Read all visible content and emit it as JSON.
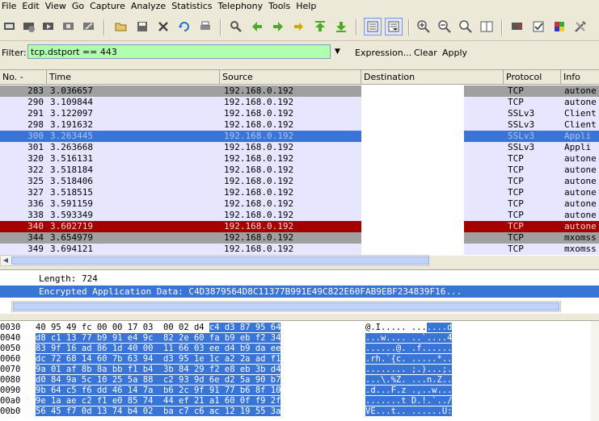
{
  "menu": [
    "File",
    "Edit",
    "View",
    "Go",
    "Capture",
    "Analyze",
    "Statistics",
    "Telephony",
    "Tools",
    "Help"
  ],
  "toolbar": {
    "icons": [
      "interface-list-icon",
      "capture-options-icon",
      "start-capture-icon",
      "stop-capture-icon",
      "restart-capture-icon",
      "open-file-icon",
      "save-file-icon",
      "close-file-icon",
      "reload-icon",
      "print-icon",
      "find-icon",
      "back-icon",
      "forward-icon",
      "goto-packet-icon",
      "first-packet-icon",
      "last-packet-icon",
      "colorize-icon",
      "autoscroll-icon",
      "zoom-in-icon",
      "zoom-out-icon",
      "zoom-normal-icon",
      "resize-columns-icon",
      "capture-filters-icon",
      "display-filters-icon",
      "coloring-rules-icon",
      "preferences-icon"
    ]
  },
  "filter": {
    "label": "Filter:",
    "value": "tcp.dstport == 443",
    "expression_label": "Expression...",
    "clear_label": "Clear",
    "apply_label": "Apply",
    "valid_color": "#afffaf"
  },
  "packet_list": {
    "columns": [
      "No. -",
      "Time",
      "Source",
      "Destination",
      "Protocol",
      "Info"
    ],
    "rows": [
      {
        "no": "283",
        "time": "3.036657",
        "source": "192.168.0.192",
        "protocol": "TCP",
        "info": "autone",
        "bg": "#a0a0a0",
        "fg": "#000000"
      },
      {
        "no": "290",
        "time": "3.109844",
        "source": "192.168.0.192",
        "protocol": "TCP",
        "info": "autone",
        "bg": "#e7e6ff",
        "fg": "#000000"
      },
      {
        "no": "291",
        "time": "3.122097",
        "source": "192.168.0.192",
        "protocol": "SSLv3",
        "info": "Client",
        "bg": "#e7e6ff",
        "fg": "#000000"
      },
      {
        "no": "298",
        "time": "3.191632",
        "source": "192.168.0.192",
        "protocol": "SSLv3",
        "info": "Client",
        "bg": "#e7e6ff",
        "fg": "#000000"
      },
      {
        "no": "300",
        "time": "3.263445",
        "source": "192.168.0.192",
        "protocol": "SSLv3",
        "info": "Appli",
        "bg": "#3875d7",
        "fg": "#a9c5ff"
      },
      {
        "no": "301",
        "time": "3.263668",
        "source": "192.168.0.192",
        "protocol": "SSLv3",
        "info": "Appli",
        "bg": "#e7e6ff",
        "fg": "#000000"
      },
      {
        "no": "320",
        "time": "3.516131",
        "source": "192.168.0.192",
        "protocol": "TCP",
        "info": "autone",
        "bg": "#e7e6ff",
        "fg": "#000000"
      },
      {
        "no": "322",
        "time": "3.518184",
        "source": "192.168.0.192",
        "protocol": "TCP",
        "info": "autone",
        "bg": "#e7e6ff",
        "fg": "#000000"
      },
      {
        "no": "325",
        "time": "3.518406",
        "source": "192.168.0.192",
        "protocol": "TCP",
        "info": "autone",
        "bg": "#e7e6ff",
        "fg": "#000000"
      },
      {
        "no": "327",
        "time": "3.518515",
        "source": "192.168.0.192",
        "protocol": "TCP",
        "info": "autone",
        "bg": "#e7e6ff",
        "fg": "#000000"
      },
      {
        "no": "336",
        "time": "3.591159",
        "source": "192.168.0.192",
        "protocol": "TCP",
        "info": "autone",
        "bg": "#e7e6ff",
        "fg": "#000000"
      },
      {
        "no": "338",
        "time": "3.593349",
        "source": "192.168.0.192",
        "protocol": "TCP",
        "info": "autone",
        "bg": "#e7e6ff",
        "fg": "#000000"
      },
      {
        "no": "340",
        "time": "3.602719",
        "source": "192.168.0.192",
        "protocol": "TCP",
        "info": "autone",
        "bg": "#a40000",
        "fg": "#ffd0d0"
      },
      {
        "no": "344",
        "time": "3.654979",
        "source": "192.168.0.192",
        "protocol": "TCP",
        "info": "mxomss",
        "bg": "#a0a0a0",
        "fg": "#000000"
      },
      {
        "no": "349",
        "time": "3.694121",
        "source": "192.168.0.192",
        "protocol": "TCP",
        "info": "mxomss",
        "bg": "#e7e6ff",
        "fg": "#000000"
      }
    ]
  },
  "details": {
    "length_line": "Length: 724",
    "data_line": "Encrypted Application Data: C4D3879564D8C11377B991E49C822E60FAB9EBF234839F16..."
  },
  "hex": {
    "rows": [
      {
        "offset": "0030",
        "pre": "40 95 49 fc 00 00 17 03  00 02 d4 ",
        "sel": "c4 d3 87 95 64",
        "apre": "@.I..... ...",
        "asel": "....d"
      },
      {
        "offset": "0040",
        "pre": "",
        "sel": "d8 c1 13 77 b9 91 e4 9c  82 2e 60 fa b9 eb f2 34",
        "apre": "",
        "asel": "...w.... ..`....4"
      },
      {
        "offset": "0050",
        "pre": "",
        "sel": "83 9f 16 ad 86 1d 40 00  11 66 03 ee d4 b9 da ee",
        "apre": "",
        "asel": "......@. .f......"
      },
      {
        "offset": "0060",
        "pre": "",
        "sel": "dc 72 68 14 60 7b 63 94  d3 95 1e 1c a2 2a ad f1",
        "apre": "",
        "asel": ".rh.`{c. .....*.."
      },
      {
        "offset": "0070",
        "pre": "",
        "sel": "9a 01 af 8b 8a bb f1 b4  3b 84 29 f2 e8 eb 3b d4",
        "apre": "",
        "asel": "........ ;.)...;."
      },
      {
        "offset": "0080",
        "pre": "",
        "sel": "d0 84 9a 5c 10 25 5a 88  c2 93 9d 6e d2 5a 90 b7",
        "apre": "",
        "asel": "...\\.%Z. ...n.Z.."
      },
      {
        "offset": "0090",
        "pre": "",
        "sel": "9b 64 c5 f6 dd 46 14 7a  b6 2c 9f 91 77 b6 8f 10",
        "apre": "",
        "asel": ".d...F.z .,..w..."
      },
      {
        "offset": "00a0",
        "pre": "",
        "sel": "9e 1a ae c2 f1 e0 85 74  44 ef 21 a1 60 0f f9 2f",
        "apre": "",
        "asel": ".......t D.!.`../"
      },
      {
        "offset": "00b0",
        "pre": "",
        "sel": "56 45 f7 0d 13 74 b4 02  ba c7 c6 ac 12 19 55 3a",
        "apre": "",
        "asel": "VE...t.. ......U:"
      }
    ]
  },
  "colors": {
    "selection": "#3875d7",
    "window_bg": "#ece9d8"
  }
}
